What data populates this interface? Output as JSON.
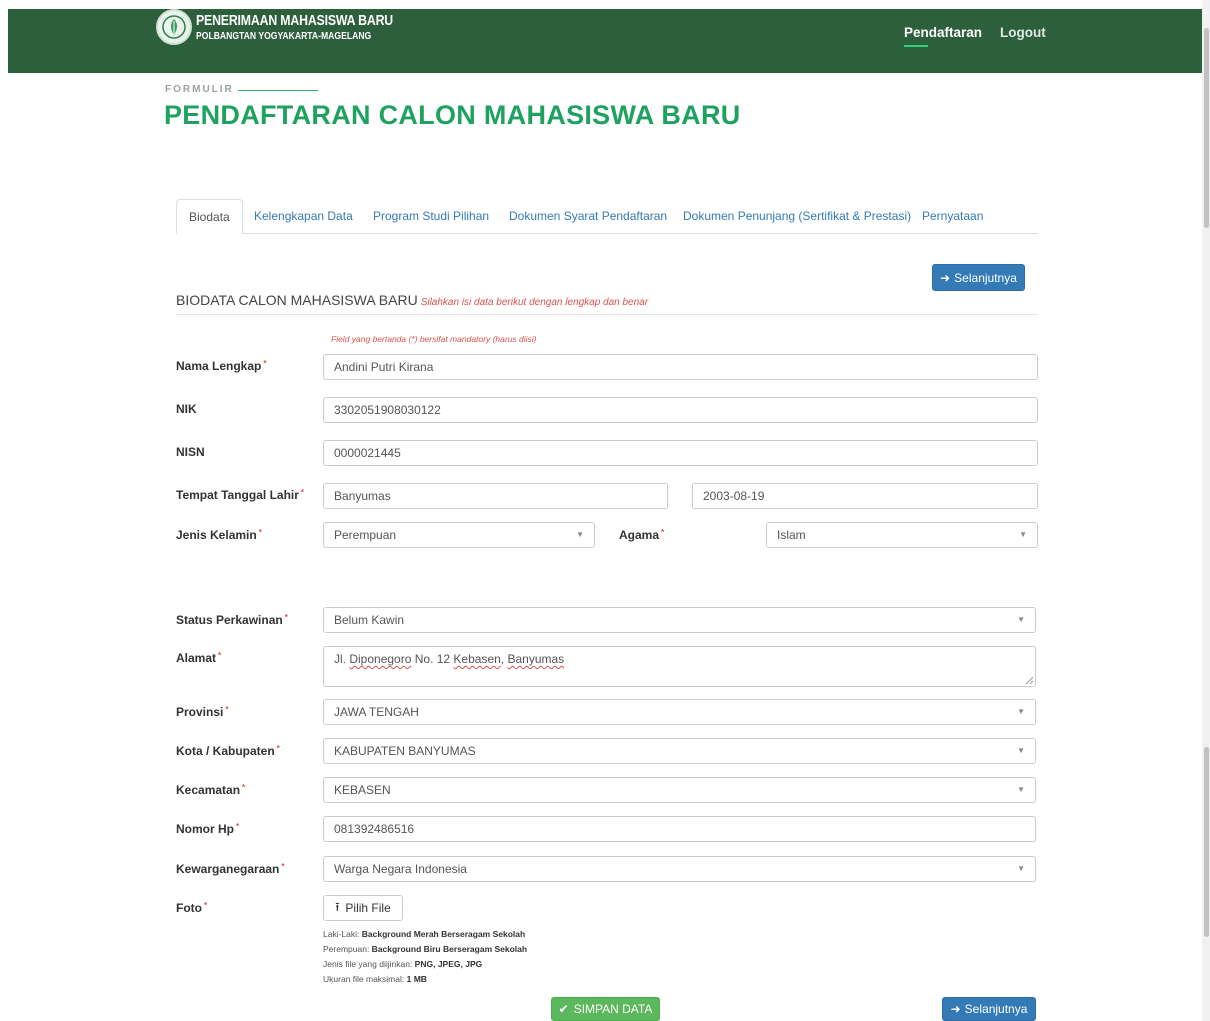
{
  "header": {
    "brand_title": "PENERIMAAN MAHASISWA BARU",
    "brand_subtitle": "POLBANGTAN YOGYAKARTA-MAGELANG",
    "nav": [
      {
        "label": "Pendaftaran",
        "active": true
      },
      {
        "label": "Logout",
        "active": false
      }
    ],
    "bar_color": "#2e5f3c"
  },
  "page": {
    "kicker": "FORMULIR",
    "title": "PENDAFTARAN CALON MAHASISWA BARU",
    "accent_color": "#1fa260"
  },
  "tabs": [
    {
      "label": "Biodata",
      "active": true
    },
    {
      "label": "Kelengkapan Data",
      "active": false
    },
    {
      "label": "Program Studi Pilihan",
      "active": false
    },
    {
      "label": "Dokumen Syarat Pendaftaran",
      "active": false
    },
    {
      "label": "Dokumen Penunjang (Sertifikat & Prestasi)",
      "active": false
    },
    {
      "label": "Pernyataan",
      "active": false
    }
  ],
  "section": {
    "title": "BIODATA CALON MAHASISWA BARU",
    "hint": "Silahkan isi data berikut dengan lengkap dan benar",
    "mandatory_note": "Field yang bertanda (*) bersifat mandatory (harus diisi)",
    "next_label": "Selanjutnya"
  },
  "form": {
    "nama": {
      "label": "Nama Lengkap",
      "value": "Andini Putri Kirana"
    },
    "nik": {
      "label": "NIK",
      "value": "3302051908030122"
    },
    "nisn": {
      "label": "NISN",
      "value": "0000021445"
    },
    "ttl": {
      "label": "Tempat Tanggal Lahir",
      "tempat": "Banyumas",
      "tanggal": "2003-08-19"
    },
    "jenis_kelamin": {
      "label": "Jenis Kelamin",
      "value": "Perempuan"
    },
    "agama": {
      "label": "Agama",
      "value": "Islam"
    },
    "status": {
      "label": "Status Perkawinan",
      "value": "Belum Kawin"
    },
    "alamat": {
      "label": "Alamat",
      "value_prefix": "Jl. ",
      "w1": "Diponegoro",
      "mid": " No. 12 ",
      "w2": "Kebasen",
      "sep": ", ",
      "w3": "Banyumas"
    },
    "provinsi": {
      "label": "Provinsi",
      "value": "JAWA TENGAH"
    },
    "kota": {
      "label": "Kota / Kabupaten",
      "value": "KABUPATEN BANYUMAS"
    },
    "kecamatan": {
      "label": "Kecamatan",
      "value": "KEBASEN"
    },
    "hp": {
      "label": "Nomor Hp",
      "value": "081392486516"
    },
    "kewarganegaraan": {
      "label": "Kewarganegaraan",
      "value": "Warga Negara Indonesia"
    },
    "foto": {
      "label": "Foto",
      "button": "Pilih File",
      "info": [
        {
          "k": "Laki-Laki: ",
          "v": "Background Merah Berseragam Sekolah"
        },
        {
          "k": "Perempuan: ",
          "v": "Background Biru Berseragam Sekolah"
        },
        {
          "k": "Jenis file yang diijinkan: ",
          "v": "PNG, JPEG, JPG"
        },
        {
          "k": "Ukuran file maksimal: ",
          "v": "1 MB"
        }
      ]
    }
  },
  "footer": {
    "save_label": "SIMPAN DATA",
    "next_label": "Selanjutnya"
  },
  "required_mark": "*"
}
